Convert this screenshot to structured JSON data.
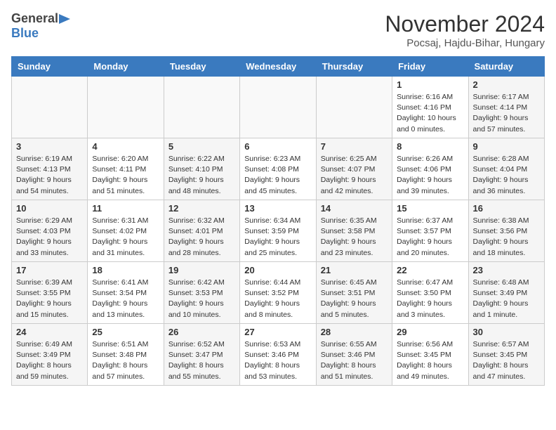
{
  "header": {
    "logo_general": "General",
    "logo_blue": "Blue",
    "month_title": "November 2024",
    "subtitle": "Pocsaj, Hajdu-Bihar, Hungary"
  },
  "days_of_week": [
    "Sunday",
    "Monday",
    "Tuesday",
    "Wednesday",
    "Thursday",
    "Friday",
    "Saturday"
  ],
  "weeks": [
    [
      {
        "day": "",
        "info": ""
      },
      {
        "day": "",
        "info": ""
      },
      {
        "day": "",
        "info": ""
      },
      {
        "day": "",
        "info": ""
      },
      {
        "day": "",
        "info": ""
      },
      {
        "day": "1",
        "info": "Sunrise: 6:16 AM\nSunset: 4:16 PM\nDaylight: 10 hours\nand 0 minutes."
      },
      {
        "day": "2",
        "info": "Sunrise: 6:17 AM\nSunset: 4:14 PM\nDaylight: 9 hours\nand 57 minutes."
      }
    ],
    [
      {
        "day": "3",
        "info": "Sunrise: 6:19 AM\nSunset: 4:13 PM\nDaylight: 9 hours\nand 54 minutes."
      },
      {
        "day": "4",
        "info": "Sunrise: 6:20 AM\nSunset: 4:11 PM\nDaylight: 9 hours\nand 51 minutes."
      },
      {
        "day": "5",
        "info": "Sunrise: 6:22 AM\nSunset: 4:10 PM\nDaylight: 9 hours\nand 48 minutes."
      },
      {
        "day": "6",
        "info": "Sunrise: 6:23 AM\nSunset: 4:08 PM\nDaylight: 9 hours\nand 45 minutes."
      },
      {
        "day": "7",
        "info": "Sunrise: 6:25 AM\nSunset: 4:07 PM\nDaylight: 9 hours\nand 42 minutes."
      },
      {
        "day": "8",
        "info": "Sunrise: 6:26 AM\nSunset: 4:06 PM\nDaylight: 9 hours\nand 39 minutes."
      },
      {
        "day": "9",
        "info": "Sunrise: 6:28 AM\nSunset: 4:04 PM\nDaylight: 9 hours\nand 36 minutes."
      }
    ],
    [
      {
        "day": "10",
        "info": "Sunrise: 6:29 AM\nSunset: 4:03 PM\nDaylight: 9 hours\nand 33 minutes."
      },
      {
        "day": "11",
        "info": "Sunrise: 6:31 AM\nSunset: 4:02 PM\nDaylight: 9 hours\nand 31 minutes."
      },
      {
        "day": "12",
        "info": "Sunrise: 6:32 AM\nSunset: 4:01 PM\nDaylight: 9 hours\nand 28 minutes."
      },
      {
        "day": "13",
        "info": "Sunrise: 6:34 AM\nSunset: 3:59 PM\nDaylight: 9 hours\nand 25 minutes."
      },
      {
        "day": "14",
        "info": "Sunrise: 6:35 AM\nSunset: 3:58 PM\nDaylight: 9 hours\nand 23 minutes."
      },
      {
        "day": "15",
        "info": "Sunrise: 6:37 AM\nSunset: 3:57 PM\nDaylight: 9 hours\nand 20 minutes."
      },
      {
        "day": "16",
        "info": "Sunrise: 6:38 AM\nSunset: 3:56 PM\nDaylight: 9 hours\nand 18 minutes."
      }
    ],
    [
      {
        "day": "17",
        "info": "Sunrise: 6:39 AM\nSunset: 3:55 PM\nDaylight: 9 hours\nand 15 minutes."
      },
      {
        "day": "18",
        "info": "Sunrise: 6:41 AM\nSunset: 3:54 PM\nDaylight: 9 hours\nand 13 minutes."
      },
      {
        "day": "19",
        "info": "Sunrise: 6:42 AM\nSunset: 3:53 PM\nDaylight: 9 hours\nand 10 minutes."
      },
      {
        "day": "20",
        "info": "Sunrise: 6:44 AM\nSunset: 3:52 PM\nDaylight: 9 hours\nand 8 minutes."
      },
      {
        "day": "21",
        "info": "Sunrise: 6:45 AM\nSunset: 3:51 PM\nDaylight: 9 hours\nand 5 minutes."
      },
      {
        "day": "22",
        "info": "Sunrise: 6:47 AM\nSunset: 3:50 PM\nDaylight: 9 hours\nand 3 minutes."
      },
      {
        "day": "23",
        "info": "Sunrise: 6:48 AM\nSunset: 3:49 PM\nDaylight: 9 hours\nand 1 minute."
      }
    ],
    [
      {
        "day": "24",
        "info": "Sunrise: 6:49 AM\nSunset: 3:49 PM\nDaylight: 8 hours\nand 59 minutes."
      },
      {
        "day": "25",
        "info": "Sunrise: 6:51 AM\nSunset: 3:48 PM\nDaylight: 8 hours\nand 57 minutes."
      },
      {
        "day": "26",
        "info": "Sunrise: 6:52 AM\nSunset: 3:47 PM\nDaylight: 8 hours\nand 55 minutes."
      },
      {
        "day": "27",
        "info": "Sunrise: 6:53 AM\nSunset: 3:46 PM\nDaylight: 8 hours\nand 53 minutes."
      },
      {
        "day": "28",
        "info": "Sunrise: 6:55 AM\nSunset: 3:46 PM\nDaylight: 8 hours\nand 51 minutes."
      },
      {
        "day": "29",
        "info": "Sunrise: 6:56 AM\nSunset: 3:45 PM\nDaylight: 8 hours\nand 49 minutes."
      },
      {
        "day": "30",
        "info": "Sunrise: 6:57 AM\nSunset: 3:45 PM\nDaylight: 8 hours\nand 47 minutes."
      }
    ]
  ]
}
